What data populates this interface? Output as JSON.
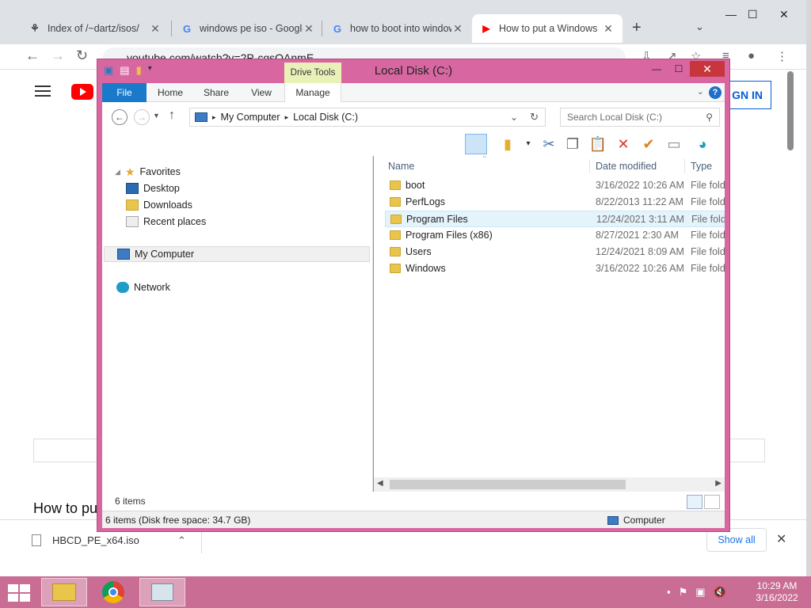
{
  "chrome": {
    "tabs": [
      {
        "title": "Index of /~dartz/isos/",
        "icon": "github-icon",
        "icon_glyph": "⚘"
      },
      {
        "title": "windows pe iso - Google Search",
        "icon": "google-icon",
        "icon_glyph": "G"
      },
      {
        "title": "how to boot into windows pe",
        "icon": "google-icon",
        "icon_glyph": "G"
      },
      {
        "title": "How to put a Windows",
        "icon": "youtube-icon",
        "icon_glyph": "▶"
      }
    ],
    "url": "youtube.com/watch?v=2P-cgsQAnmE",
    "signin_label": "GN IN",
    "video_title": "How to pu"
  },
  "downloads": {
    "filename": "HBCD_PE_x64.iso",
    "show_all": "Show all"
  },
  "explorer": {
    "title": "Local Disk (C:)",
    "drive_tools": "Drive Tools",
    "ribbon_tabs": [
      "File",
      "Home",
      "Share",
      "View",
      "Manage"
    ],
    "breadcrumb": [
      "My Computer",
      "Local Disk (C:)"
    ],
    "search_placeholder": "Search Local Disk (C:)",
    "nav": {
      "favorites": "Favorites",
      "desktop": "Desktop",
      "downloads": "Downloads",
      "recent": "Recent places",
      "computer": "My Computer",
      "network": "Network"
    },
    "columns": [
      "Name",
      "Date modified",
      "Type"
    ],
    "files": [
      {
        "name": "boot",
        "date": "3/16/2022 10:26 AM",
        "type": "File folder"
      },
      {
        "name": "PerfLogs",
        "date": "8/22/2013 11:22 AM",
        "type": "File folder"
      },
      {
        "name": "Program Files",
        "date": "12/24/2021 3:11 AM",
        "type": "File folder"
      },
      {
        "name": "Program Files (x86)",
        "date": "8/27/2021 2:30 AM",
        "type": "File folder"
      },
      {
        "name": "Users",
        "date": "12/24/2021 8:09 AM",
        "type": "File folder"
      },
      {
        "name": "Windows",
        "date": "3/16/2022 10:26 AM",
        "type": "File folder"
      }
    ],
    "selected_file_index": 2,
    "items_count": "6 items",
    "status_left": "6 items (Disk free space: 34.7 GB)",
    "status_right": "Computer"
  },
  "taskbar": {
    "apps": [
      "explorer-icon",
      "chrome-icon",
      "task-manager-icon"
    ],
    "time": "10:29 AM",
    "date": "3/16/2022"
  },
  "colors": {
    "window_frame": "#d867a1",
    "taskbar": "#c96d94",
    "file_tab": "#1979ca",
    "close_button": "#c7363d"
  }
}
